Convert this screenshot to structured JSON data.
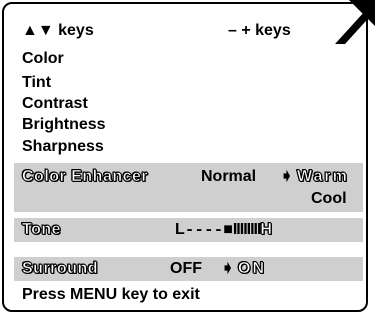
{
  "header": {
    "nav_keys": "▲▼ keys",
    "adjust_keys": "– + keys"
  },
  "menu_items": [
    "Color",
    "Tint",
    "Contrast",
    "Brightness",
    "Sharpness"
  ],
  "color_enhancer": {
    "label": "Color Enhancer",
    "option_normal": "Normal",
    "pointer": "➧",
    "option_warm": "Warm",
    "option_cool": "Cool"
  },
  "tone": {
    "label": "Tone",
    "left": "L",
    "dashes": "----",
    "marker": "■",
    "bars": "IIIIIIII",
    "right": "H"
  },
  "surround": {
    "label": "Surround",
    "option_off": "OFF",
    "pointer": "➧",
    "option_on": "ON"
  },
  "footer": {
    "exit_hint": "Press MENU key to exit"
  }
}
